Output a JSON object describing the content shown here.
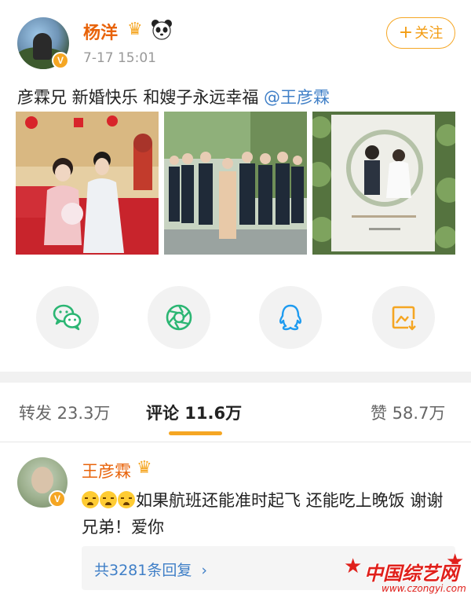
{
  "post": {
    "author": "杨洋",
    "timestamp": "7-17 15:01",
    "follow_label": "关注",
    "follow_plus": "+",
    "text": "彦霖兄 新婚快乐 和嫂子永远幸福 ",
    "mention": "@王彦霖",
    "images": [
      {
        "icon": "wedding-couple-photo"
      },
      {
        "icon": "groomsmen-photo"
      },
      {
        "icon": "wedding-invitation-photo"
      }
    ]
  },
  "share": {
    "items": [
      {
        "icon": "wechat-icon",
        "color": "#2bb673"
      },
      {
        "icon": "moments-icon",
        "color": "#2bb673"
      },
      {
        "icon": "qq-icon",
        "color": "#1e9bf0"
      },
      {
        "icon": "save-image-icon",
        "color": "#f5a623"
      }
    ]
  },
  "tabs": {
    "repost": "转发 23.3万",
    "comments": "评论 11.6万",
    "likes": "赞 58.7万"
  },
  "comment": {
    "author": "王彦霖",
    "text": "如果航班还能准时起飞 还能吃上晚饭 谢谢兄弟！爱你",
    "replies": "共3281条回复",
    "replies_arrow": "›"
  },
  "watermark": {
    "text": "中国综艺网",
    "url": "www.czongyi.com"
  },
  "colors": {
    "accent": "#f5a623",
    "username": "#e8630a",
    "link": "#3f7fc7"
  }
}
